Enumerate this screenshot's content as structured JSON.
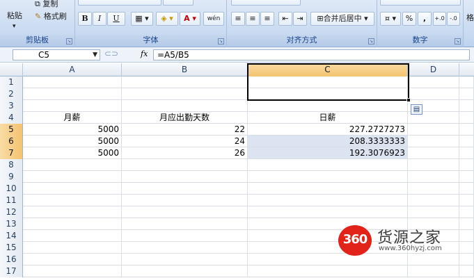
{
  "ribbon": {
    "clipboard": {
      "paste": "粘贴",
      "copy": "复制",
      "format_painter": "格式刷",
      "label": "剪贴板"
    },
    "font": {
      "bold": "B",
      "italic": "I",
      "underline": "U",
      "font_color": "A",
      "phonetic": "wén",
      "label": "字体"
    },
    "alignment": {
      "merge_center": "合并后居中",
      "label": "对齐方式"
    },
    "number": {
      "percent": "%",
      "comma": ",",
      "inc_decimal": ".00→.0",
      "dec_decimal": ".00→.0",
      "label": "数字"
    },
    "extra": "格"
  },
  "formula_bar": {
    "name_box": "C5",
    "fx_label": "fx",
    "formula": "=A5/B5"
  },
  "columns": [
    "A",
    "B",
    "C",
    "D"
  ],
  "selected_column": "C",
  "rows": [
    {
      "n": "1",
      "a": "",
      "b": "",
      "c": ""
    },
    {
      "n": "2",
      "a": "",
      "b": "",
      "c": ""
    },
    {
      "n": "3",
      "a": "",
      "b": "",
      "c": ""
    },
    {
      "n": "4",
      "a": "月薪",
      "b": "月应出勤天数",
      "c": "日薪"
    },
    {
      "n": "5",
      "a": "5000",
      "b": "22",
      "c": "227.2727273"
    },
    {
      "n": "6",
      "a": "5000",
      "b": "24",
      "c": "208.3333333"
    },
    {
      "n": "7",
      "a": "5000",
      "b": "26",
      "c": "192.3076923"
    },
    {
      "n": "8",
      "a": "",
      "b": "",
      "c": ""
    },
    {
      "n": "9",
      "a": "",
      "b": "",
      "c": ""
    },
    {
      "n": "10",
      "a": "",
      "b": "",
      "c": ""
    },
    {
      "n": "11",
      "a": "",
      "b": "",
      "c": ""
    },
    {
      "n": "12",
      "a": "",
      "b": "",
      "c": ""
    },
    {
      "n": "13",
      "a": "",
      "b": "",
      "c": ""
    },
    {
      "n": "14",
      "a": "",
      "b": "",
      "c": ""
    },
    {
      "n": "15",
      "a": "",
      "b": "",
      "c": ""
    },
    {
      "n": "16",
      "a": "",
      "b": "",
      "c": ""
    },
    {
      "n": "17",
      "a": "",
      "b": "",
      "c": ""
    }
  ],
  "watermark": {
    "badge": "360",
    "name": "货源之家",
    "url": "www.360hyzj.com"
  },
  "colors": {
    "selection_header": "#f3c36e",
    "selection_fill": "#dde4f1",
    "brand_red": "#e2231a"
  }
}
